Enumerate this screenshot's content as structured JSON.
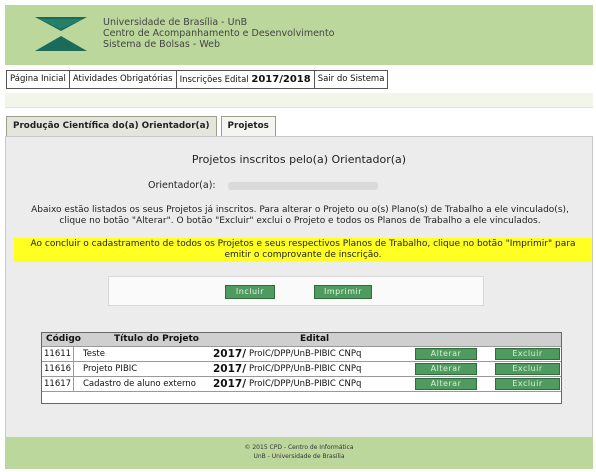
{
  "header": {
    "line1": "Universidade de Brasília - UnB",
    "line2": "Centro de Acompanhamento e Desenvolvimento",
    "line3": "Sistema de Bolsas - Web"
  },
  "menu": {
    "home": "Página Inicial",
    "activities": "Atividades Obrigatórias",
    "inscriptions": "Inscrições Edital",
    "inscriptions_year": "2017/2018",
    "logout": "Sair do Sistema"
  },
  "tabs": {
    "production": "Produção Científica do(a) Orientador(a)",
    "projects": "Projetos"
  },
  "panel": {
    "title": "Projetos inscritos pelo(a) Orientador(a)",
    "orientador_label": "Orientador(a):",
    "description": "Abaixo estão listados os seus Projetos já inscritos. Para alterar o Projeto ou o(s) Plano(s) de Trabalho a ele vinculado(s), clique no botão \"Alterar\". O botão \"Excluir\" exclui o Projeto e todos os Planos de Trabalho a ele vinculados.",
    "notice": "Ao concluir o cadastramento de todos os Projetos e seus respectivos Planos de Trabalho, clique no botão \"Imprimir\" para emitir o comprovante de inscrição.",
    "btn_include": "Incluir",
    "btn_print": "Imprimir"
  },
  "table": {
    "headers": {
      "code": "Código",
      "title": "Título do Projeto",
      "edital": "Edital"
    },
    "rows": [
      {
        "code": "11611",
        "title": "Teste",
        "year": "2017/",
        "edital": "ProIC/DPP/UnB-PIBIC CNPq",
        "alter": "Alterar",
        "delete": "Excluir"
      },
      {
        "code": "11616",
        "title": "Projeto PIBIC",
        "year": "2017/",
        "edital": "ProIC/DPP/UnB-PIBIC CNPq",
        "alter": "Alterar",
        "delete": "Excluir"
      },
      {
        "code": "11617",
        "title": "Cadastro de aluno externo",
        "year": "2017/",
        "edital": "ProIC/DPP/UnB-PIBIC CNPq",
        "alter": "Alterar",
        "delete": "Excluir"
      }
    ]
  },
  "footer": {
    "line1": "© 2015 CPD - Centro de Informática",
    "line2": "UnB - Universidade de Brasília"
  },
  "colors": {
    "header_bg": "#bcd79c",
    "button_green": "#4f9b5f",
    "notice_yellow": "#ffff22",
    "logo_teal": "#1b6b5a"
  }
}
